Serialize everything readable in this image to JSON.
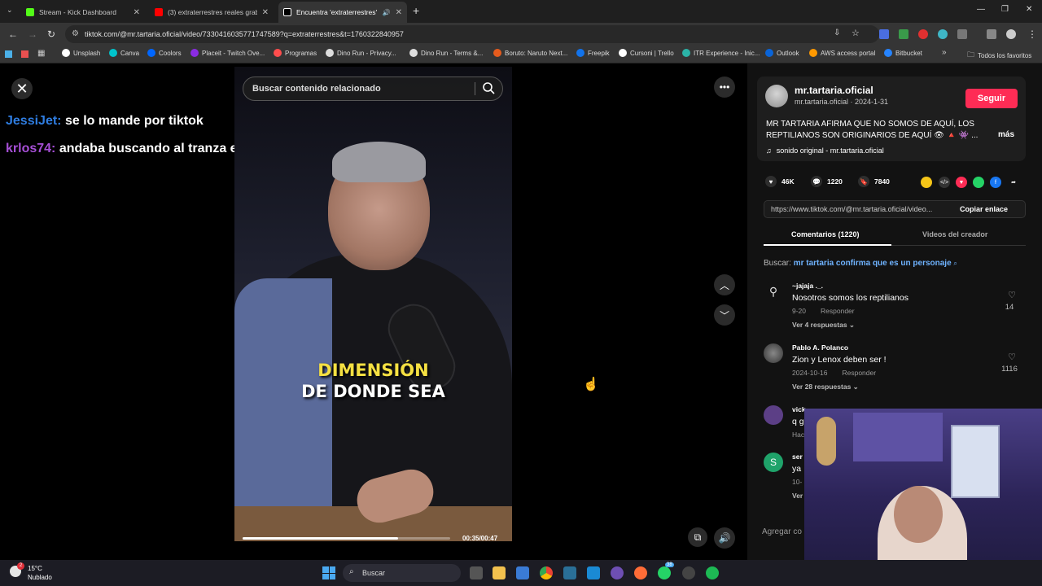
{
  "browser": {
    "tabs": [
      {
        "title": "Stream - Kick Dashboard",
        "color": "#53fc18"
      },
      {
        "title": "(3) extraterrestres reales grabad",
        "color": "#ff0000"
      },
      {
        "title": "Encuentra 'extraterrestres' e",
        "color": "#ffffff"
      }
    ],
    "new_tab": "+",
    "url": "tiktok.com/@mr.tartaria.oficial/video/7330416035771747589?q=extraterrestres&t=1760322840957",
    "bookmarks": [
      {
        "label": "Unsplash",
        "color": "#ffffff"
      },
      {
        "label": "Canva",
        "color": "#00c4cc"
      },
      {
        "label": "Coolors",
        "color": "#0066ff"
      },
      {
        "label": "Placeit - Twitch Ove...",
        "color": "#8a2be2"
      },
      {
        "label": "Programas",
        "color": "#ff4d4d"
      },
      {
        "label": "Dino Run - Privacy...",
        "color": "#dddddd"
      },
      {
        "label": "Dino Run - Terms &...",
        "color": "#dddddd"
      },
      {
        "label": "Boruto: Naruto Next...",
        "color": "#e55b1d"
      },
      {
        "label": "Freepik",
        "color": "#1273eb"
      },
      {
        "label": "Cursoni | Trello",
        "color": "#ffffff"
      },
      {
        "label": "ITR Experience - Inic...",
        "color": "#2bb3a7"
      },
      {
        "label": "Outlook",
        "color": "#0a64d8"
      },
      {
        "label": "AWS access portal",
        "color": "#ff9900"
      },
      {
        "label": "Bitbucket",
        "color": "#2684ff"
      }
    ],
    "all_bookmarks": "Todos los favoritos"
  },
  "chat": [
    {
      "user": "JessiJet:",
      "message": "se lo mande por tiktok"
    },
    {
      "user": "krlos74:",
      "message": "andaba buscando al tranza el alien jaa"
    }
  ],
  "video": {
    "search_placeholder": "Buscar contenido relacionado",
    "caption_line1": "DIMENSIÓN",
    "caption_line2": "DE DONDE SEA",
    "time": "00:35/00:47",
    "progress": 0.75
  },
  "panel": {
    "username": "mr.tartaria.oficial",
    "subline": "mr.tartaria.oficial · 2024-1-31",
    "follow": "Seguir",
    "description": "MR TARTARIA AFIRMA QUE NO SOMOS DE AQUÍ, LOS REPTILIANOS SON ORIGINARIOS DE AQUÍ 👁 🔺 👾 ...",
    "more": "más",
    "sound": "sonido original - mr.tartaria.oficial",
    "likes": "46K",
    "comments": "1220",
    "saves": "7840",
    "link": "https://www.tiktok.com/@mr.tartaria.oficial/video...",
    "copy_link": "Copiar enlace",
    "tab_comments": "Comentarios (1220)",
    "tab_creator": "Videos del creador",
    "related_prefix": "Buscar:",
    "related_keyword": "mr tartaria confirma que es un personaje",
    "add_comment": "Agregar co",
    "comment_list": [
      {
        "name": "~jajaja ._.",
        "text": "Nosotros somos los reptilianos",
        "date": "9-20",
        "reply": "Responder",
        "replies": "Ver 4 respuestas ⌄",
        "likes": "14"
      },
      {
        "name": "Pablo A. Polanco",
        "text": "Zion y Lenox deben ser !",
        "date": "2024-10-16",
        "reply": "Responder",
        "replies": "Ver 28 respuestas ⌄",
        "likes": "1116"
      }
    ],
    "partial_comments": [
      {
        "name": "vick",
        "text": "q g",
        "meta": "Hac"
      },
      {
        "name": "ser",
        "text": "ya",
        "meta": "10-",
        "extra": "Ver"
      }
    ]
  },
  "taskbar": {
    "temp": "15°C",
    "condition": "Nublado",
    "search": "Buscar",
    "notif_badge": "2",
    "whatsapp_badge": "38"
  }
}
